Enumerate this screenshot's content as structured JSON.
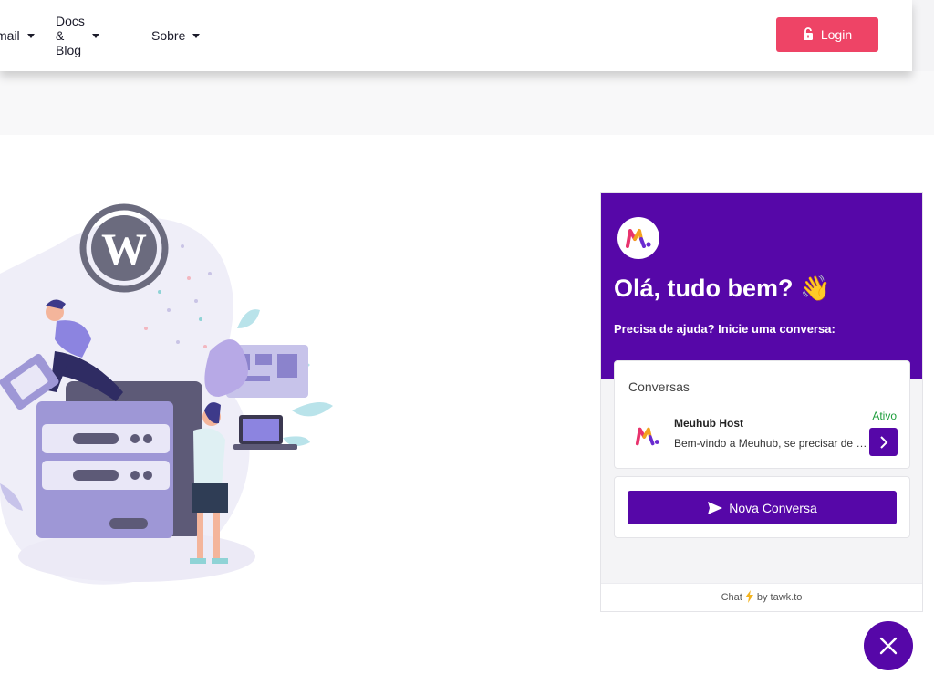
{
  "nav": {
    "items": [
      {
        "label": "mail"
      },
      {
        "label": "Docs & Blog"
      },
      {
        "label": "Sobre"
      }
    ],
    "login_label": "Login"
  },
  "chat": {
    "title": "Olá, tudo bem? 👋",
    "subtitle": "Precisa de ajuda? Inicie uma conversa:",
    "conversations_header": "Conversas",
    "conversation": {
      "name": "Meuhub Host",
      "status": "Ativo",
      "preview": "Bem-vindo a Meuhub, se precisar de ajuda, é só chamar!"
    },
    "new_conversation_label": "Nova Conversa",
    "footer_prefix": "Chat",
    "footer_suffix": "by tawk.to"
  },
  "colors": {
    "brand_purple": "#5607a8",
    "login_pink": "#ee4466",
    "status_green": "#1e9e3c"
  }
}
